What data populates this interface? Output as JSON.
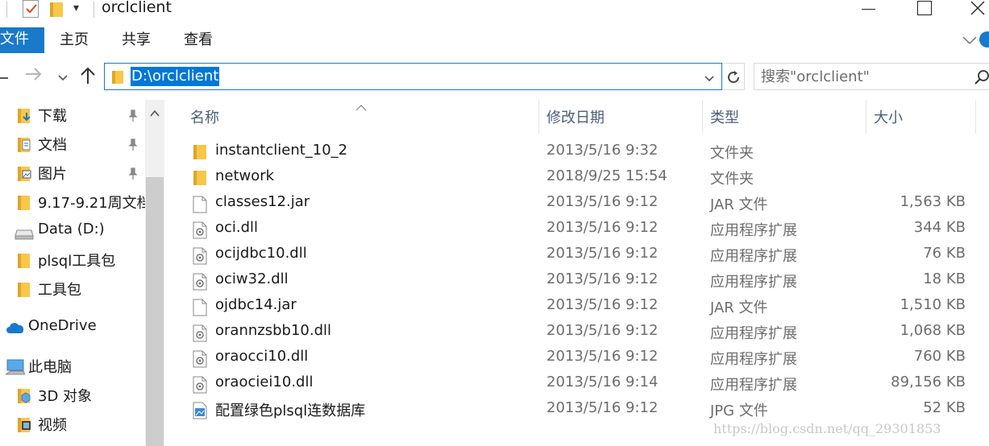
{
  "window": {
    "title": "orclclient"
  },
  "ribbon": {
    "tabs": [
      "文件",
      "主页",
      "共享",
      "查看"
    ]
  },
  "address": {
    "path": "D:\\orclclient",
    "search_placeholder": "搜索\"orclclient\""
  },
  "nav_pane": {
    "items": [
      {
        "label": "下载",
        "icon": "download-folder-icon",
        "pinned": true
      },
      {
        "label": "文档",
        "icon": "documents-folder-icon",
        "pinned": true
      },
      {
        "label": "图片",
        "icon": "pictures-folder-icon",
        "pinned": true
      },
      {
        "label": "9.17-9.21周文档",
        "icon": "folder-icon",
        "pinned": false
      },
      {
        "label": "Data (D:)",
        "icon": "drive-icon",
        "pinned": false
      },
      {
        "label": "plsql工具包",
        "icon": "folder-icon",
        "pinned": false
      },
      {
        "label": "工具包",
        "icon": "folder-icon",
        "pinned": false
      },
      {
        "label": "OneDrive",
        "icon": "onedrive-icon",
        "pinned": false
      },
      {
        "label": "此电脑",
        "icon": "this-pc-icon",
        "pinned": false
      },
      {
        "label": "3D 对象",
        "icon": "3d-objects-icon",
        "pinned": false
      },
      {
        "label": "视频",
        "icon": "videos-icon",
        "pinned": false
      }
    ]
  },
  "file_list": {
    "columns": {
      "name": "名称",
      "date": "修改日期",
      "type": "类型",
      "size": "大小"
    },
    "rows": [
      {
        "name": "instantclient_10_2",
        "date": "2013/5/16 9:32",
        "type": "文件夹",
        "size": "",
        "icon": "folder-icon"
      },
      {
        "name": "network",
        "date": "2018/9/25 15:54",
        "type": "文件夹",
        "size": "",
        "icon": "folder-icon"
      },
      {
        "name": "classes12.jar",
        "date": "2013/5/16 9:12",
        "type": "JAR 文件",
        "size": "1,563 KB",
        "icon": "file-icon"
      },
      {
        "name": "oci.dll",
        "date": "2013/5/16 9:12",
        "type": "应用程序扩展",
        "size": "344 KB",
        "icon": "dll-icon"
      },
      {
        "name": "ocijdbc10.dll",
        "date": "2013/5/16 9:12",
        "type": "应用程序扩展",
        "size": "76 KB",
        "icon": "dll-icon"
      },
      {
        "name": "ociw32.dll",
        "date": "2013/5/16 9:12",
        "type": "应用程序扩展",
        "size": "18 KB",
        "icon": "dll-icon"
      },
      {
        "name": "ojdbc14.jar",
        "date": "2013/5/16 9:12",
        "type": "JAR 文件",
        "size": "1,510 KB",
        "icon": "file-icon"
      },
      {
        "name": "orannzsbb10.dll",
        "date": "2013/5/16 9:12",
        "type": "应用程序扩展",
        "size": "1,068 KB",
        "icon": "dll-icon"
      },
      {
        "name": "oraocci10.dll",
        "date": "2013/5/16 9:12",
        "type": "应用程序扩展",
        "size": "760 KB",
        "icon": "dll-icon"
      },
      {
        "name": "oraociei10.dll",
        "date": "2013/5/16 9:14",
        "type": "应用程序扩展",
        "size": "89,156 KB",
        "icon": "dll-icon"
      },
      {
        "name": "配置绿色plsql连数据库",
        "date": "2013/5/16 9:12",
        "type": "JPG 文件",
        "size": "52 KB",
        "icon": "image-file-icon"
      }
    ]
  },
  "watermark": "https://blog.csdn.net/qq_29301853",
  "colors": {
    "accent": "#1979ca",
    "folder": "#f8c74a",
    "selection": "#0078d7"
  }
}
